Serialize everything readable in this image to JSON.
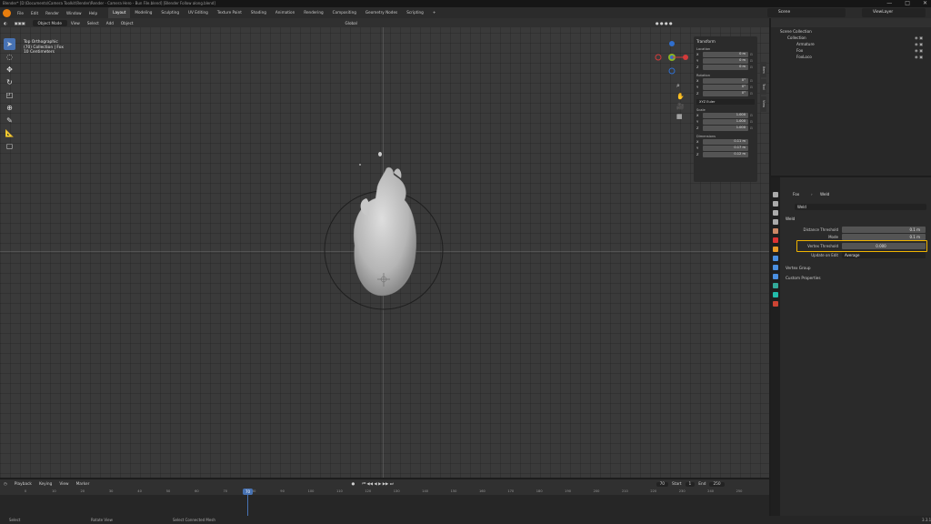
{
  "window": {
    "title": "Blender* [D:\\Documents\\Camera Toolkit\\Render\\Render - Camera Hero - Bun File.blend] [Blender Follow along.blend]",
    "controls": [
      "—",
      "□",
      "✕"
    ]
  },
  "menu": {
    "items": [
      "File",
      "Edit",
      "Render",
      "Window",
      "Help"
    ],
    "workspaces": [
      "Layout",
      "Modeling",
      "Sculpting",
      "UV Editing",
      "Texture Paint",
      "Shading",
      "Animation",
      "Rendering",
      "Compositing",
      "Geometry Nodes",
      "Scripting"
    ],
    "active_workspace": "Layout",
    "add_tab": "+",
    "scene": "Scene",
    "view_layer": "ViewLayer"
  },
  "viewport_header": {
    "mode": "Object Mode",
    "menus": [
      "View",
      "Select",
      "Add",
      "Object"
    ],
    "transform": "Global",
    "options": "Options"
  },
  "viewport": {
    "view_name": "Top Orthographic",
    "collection_info": "(70) Collection | Fox",
    "scale": "10 Centimeters"
  },
  "npanel": {
    "section": "Transform",
    "location": {
      "label": "Location",
      "x": "0 m",
      "y": "0 m",
      "z": "0 m"
    },
    "rotation": {
      "label": "Rotation",
      "x": "0°",
      "y": "0°",
      "z": "0°"
    },
    "rotation_mode": "XYZ Euler",
    "scale": {
      "label": "Scale",
      "x": "1.000",
      "y": "1.000",
      "z": "1.000"
    },
    "dimensions": {
      "label": "Dimensions",
      "x": "0.11 m",
      "y": "0.17 m",
      "z": "0.12 m"
    },
    "tabs": [
      "Item",
      "Tool",
      "View"
    ]
  },
  "timeline": {
    "menus": [
      "Playback",
      "Keying",
      "View",
      "Marker"
    ],
    "current_frame": "70",
    "start_label": "Start",
    "start": "1",
    "end_label": "End",
    "end": "250",
    "ticks": [
      "0",
      "10",
      "20",
      "30",
      "40",
      "50",
      "60",
      "70",
      "80",
      "90",
      "100",
      "110",
      "120",
      "130",
      "140",
      "150",
      "160",
      "170",
      "180",
      "190",
      "200",
      "210",
      "220",
      "230",
      "240",
      "250"
    ]
  },
  "outliner": {
    "root": "Scene Collection",
    "items": [
      {
        "name": "Collection",
        "level": 1
      },
      {
        "name": "Armature",
        "level": 2
      },
      {
        "name": "Fox",
        "level": 2
      },
      {
        "name": "FoxLoco",
        "level": 2
      }
    ]
  },
  "properties": {
    "breadcrumb_object": "Fox",
    "breadcrumb_modifier": "Weld",
    "modifier_name": "Weld",
    "panel": "Weld",
    "fields": [
      {
        "label": "Distance Threshold",
        "value": "0.1 m"
      },
      {
        "label": "Mode",
        "value": "0.1 m"
      },
      {
        "label": "Vertex Threshold",
        "value": "0.000"
      },
      {
        "label": "Update on Edit",
        "value": "Average"
      }
    ],
    "subpanels": [
      "Vertex Group",
      "Custom Properties"
    ]
  },
  "status": {
    "items": [
      "Select",
      "Rotate View",
      "Select Connected Mesh"
    ],
    "version": "3.3.1"
  }
}
